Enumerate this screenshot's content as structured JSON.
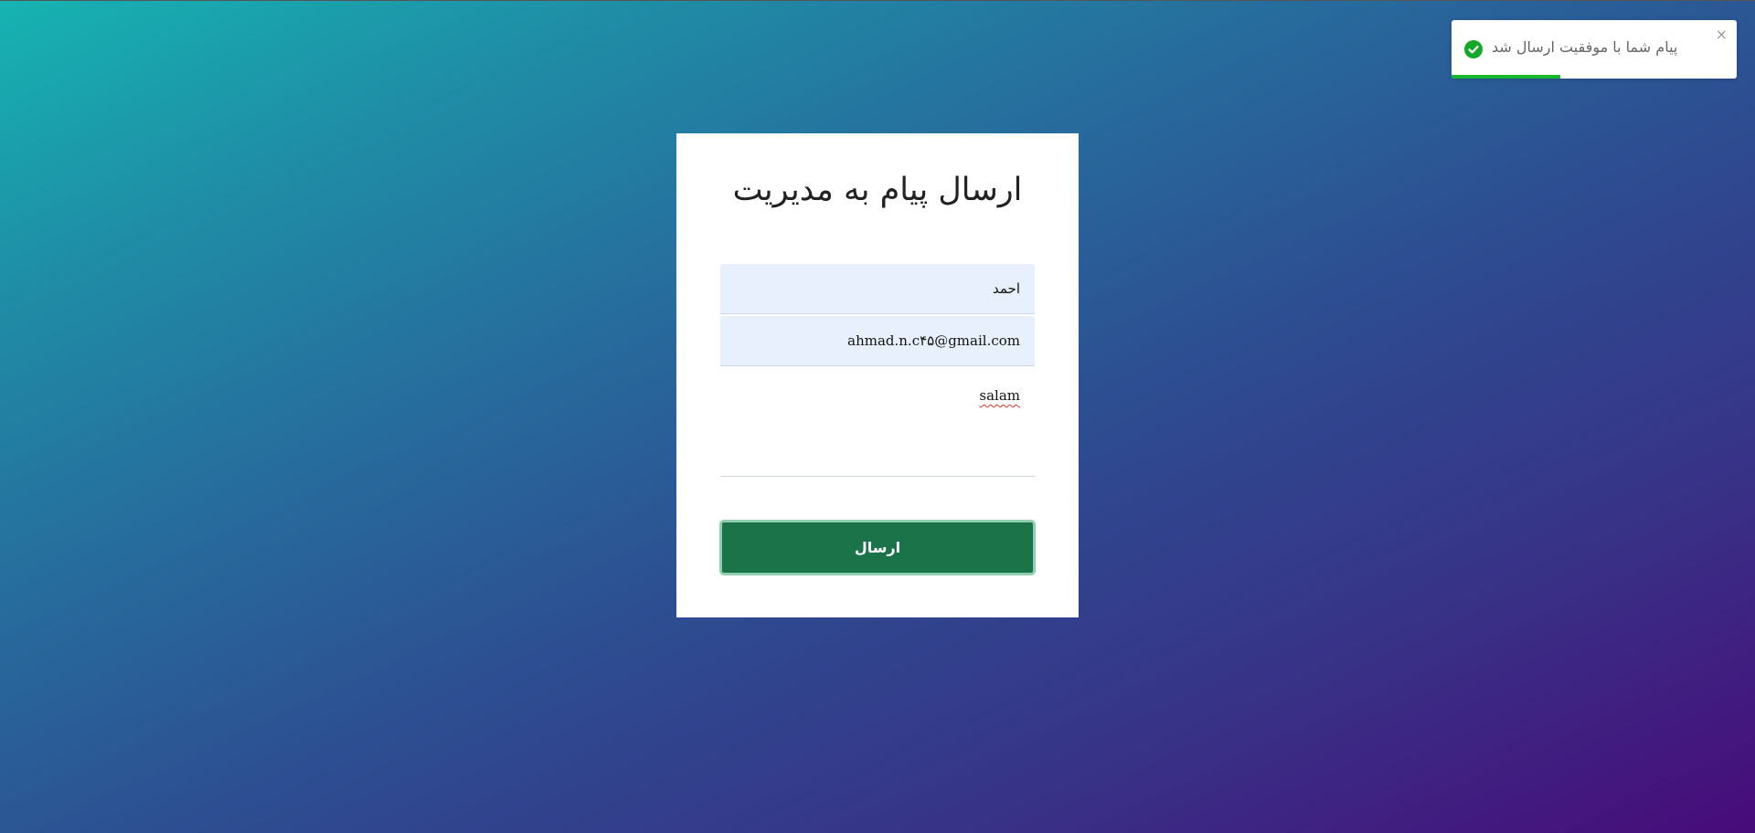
{
  "form": {
    "title": "ارسال پیام به مدیریت",
    "name_value": "احمد",
    "email_value": "ahmad.n.c۴۵@gmail.com",
    "message_value": "salam",
    "submit_label": "ارسال"
  },
  "toast": {
    "message": "پیام شما با موفقیت ارسال شد",
    "status_icon": "check-circle-icon",
    "close_glyph": "×",
    "progress": 0.38,
    "accent_color": "#16b82e"
  },
  "colors": {
    "button": "#1a7349",
    "input_autofill": "#e8f0fe"
  }
}
